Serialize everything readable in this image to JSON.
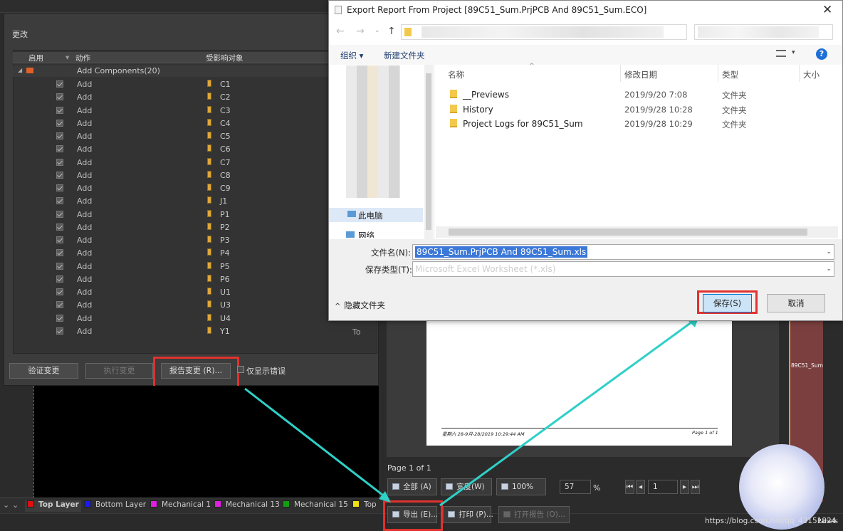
{
  "eco": {
    "group_title": "更改",
    "col_enable": "启用",
    "col_action": "动作",
    "col_target": "受影响对象",
    "group_row": "Add Components(20)",
    "rows": [
      {
        "action": "Add",
        "obj": "C1"
      },
      {
        "action": "Add",
        "obj": "C2"
      },
      {
        "action": "Add",
        "obj": "C3"
      },
      {
        "action": "Add",
        "obj": "C4"
      },
      {
        "action": "Add",
        "obj": "C5"
      },
      {
        "action": "Add",
        "obj": "C6"
      },
      {
        "action": "Add",
        "obj": "C7"
      },
      {
        "action": "Add",
        "obj": "C8"
      },
      {
        "action": "Add",
        "obj": "C9"
      },
      {
        "action": "Add",
        "obj": "J1"
      },
      {
        "action": "Add",
        "obj": "P1"
      },
      {
        "action": "Add",
        "obj": "P2"
      },
      {
        "action": "Add",
        "obj": "P3"
      },
      {
        "action": "Add",
        "obj": "P4"
      },
      {
        "action": "Add",
        "obj": "P5"
      },
      {
        "action": "Add",
        "obj": "P6"
      },
      {
        "action": "Add",
        "obj": "U1"
      },
      {
        "action": "Add",
        "obj": "U3"
      },
      {
        "action": "Add",
        "obj": "U4"
      },
      {
        "action": "Add",
        "obj": "Y1"
      }
    ],
    "last_to": "To",
    "btn_validate": "验证变更",
    "btn_execute": "执行变更",
    "btn_report": "报告变更 (R)...",
    "only_errors": "仅显示错误"
  },
  "layers": [
    {
      "name": "Top Layer",
      "color": "#e01010"
    },
    {
      "name": "Bottom Layer",
      "color": "#1a1aee"
    },
    {
      "name": "Mechanical 1",
      "color": "#e020e0"
    },
    {
      "name": "Mechanical 13",
      "color": "#e020e0"
    },
    {
      "name": "Mechanical 15",
      "color": "#10a010"
    },
    {
      "name": "Top",
      "color": "#f0e010"
    }
  ],
  "preview": {
    "footer_left": "星期六 28-9月-28/2019 10:29:44 AM",
    "footer_right": "Page 1 of 1",
    "page_label": "Page 1 of 1",
    "btn_all": "全部 (A)",
    "btn_width": "宽度(W)",
    "btn_100": "100%",
    "zoom": "57",
    "pct": "%",
    "page_num": "1",
    "btn_export": "导出 (E)...",
    "btn_print": "打印 (P)...",
    "btn_open": "打开报告 (O)...",
    "strip_label": "89C51_Sum"
  },
  "dialog": {
    "title": "Export Report From Project [89C51_Sum.PrjPCB And 89C51_Sum.ECO]",
    "organize": "组织 ▾",
    "new_folder": "新建文件夹",
    "col_name": "名称",
    "col_date": "修改日期",
    "col_type": "类型",
    "col_size": "大小",
    "files": [
      {
        "name": "__Previews",
        "date": "2019/9/20 7:08",
        "type": "文件夹"
      },
      {
        "name": "History",
        "date": "2019/9/28 10:28",
        "type": "文件夹"
      },
      {
        "name": "Project Logs for 89C51_Sum",
        "date": "2019/9/28 10:29",
        "type": "文件夹"
      }
    ],
    "nav_pc": "此电脑",
    "nav_net": "网络",
    "lbl_filename": "文件名(N):",
    "filename": "89C51_Sum.PrjPCB And 89C51_Sum.xls",
    "lbl_type": "保存类型(T):",
    "filetype": "Microsoft Excel Worksheet (*.xls)",
    "hide_folders": "隐藏文件夹",
    "btn_save": "保存(S)",
    "btn_cancel": "取消"
  },
  "watermark": "https://blog.csdn.net/qq_43151824",
  "panels_label": "Panels"
}
